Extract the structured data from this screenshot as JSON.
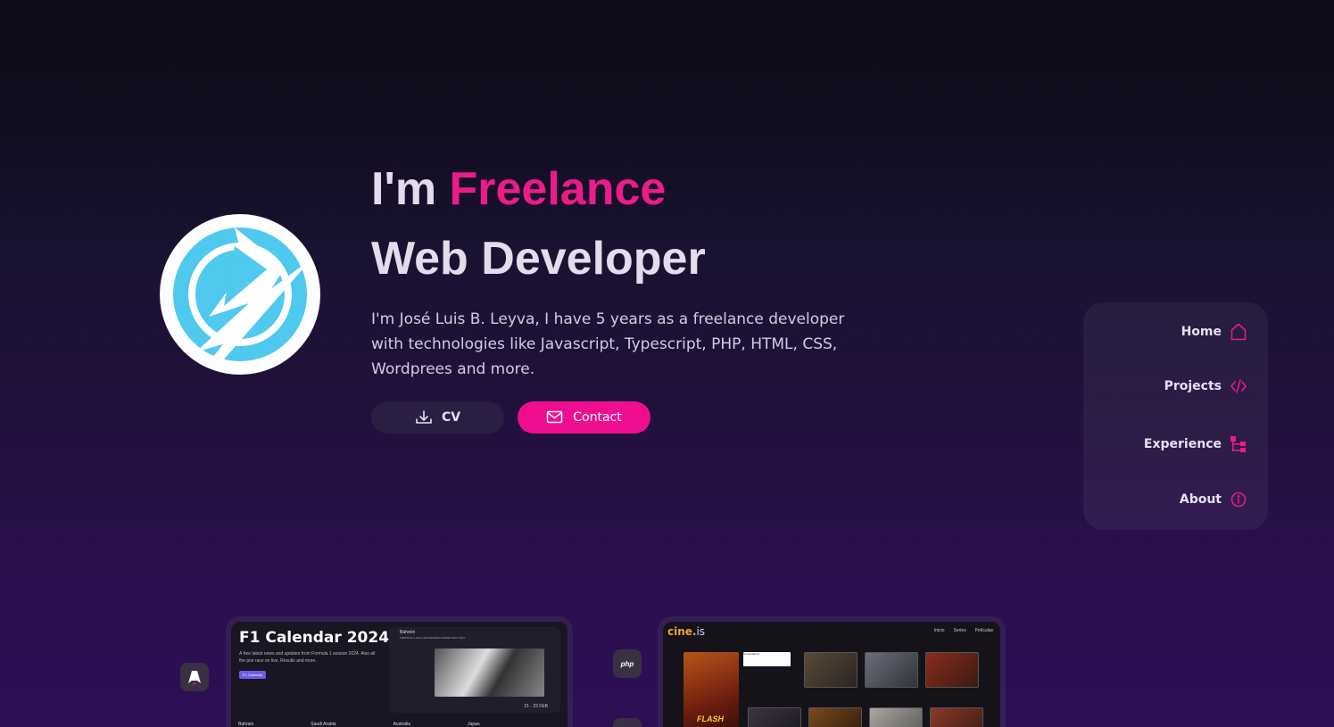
{
  "hero": {
    "title_prefix": "I'm ",
    "title_accent": "Freelance",
    "title_line2": "Web Developer",
    "description": "I'm José Luis B. Leyva, I have 5 years as a freelance developer with technologies like Javascript, Typescript, PHP, HTML, CSS, Wordprees and more.",
    "cv_label": "CV",
    "contact_label": "Contact"
  },
  "nav": {
    "items": [
      {
        "label": "Home",
        "icon": "home-icon"
      },
      {
        "label": "Projects",
        "icon": "code-icon"
      },
      {
        "label": "Experience",
        "icon": "sitemap-icon"
      },
      {
        "label": "About",
        "icon": "info-icon"
      }
    ]
  },
  "projects": {
    "f1": {
      "title": "F1 Calendar 2024",
      "subtitle": "A free latest news and updates from Formula 1 season 2024. Also all the pos race on live, Results and more.",
      "badge": "F1 Calendar",
      "panel_label": "Bahrein",
      "panel_sub": "FORMULA 1 GULF AIR BAHRAIN GRAND PRIX 2024",
      "date": "21 - 23 FEB",
      "countries": [
        "Bahrain",
        "Saudi Arabia",
        "Australia",
        "Japan"
      ]
    },
    "cine": {
      "logo_main": "cine.",
      "logo_sub": "is",
      "nav": [
        "Inicio",
        "Series",
        "Películas"
      ],
      "dropdown": "Temporada 8",
      "flash": "FLASH"
    },
    "tech_chips": [
      "php"
    ]
  },
  "colors": {
    "accent": "#ec1b8a",
    "button_secondary": "#2a1f42",
    "logo_blue": "#4fc9ee"
  }
}
